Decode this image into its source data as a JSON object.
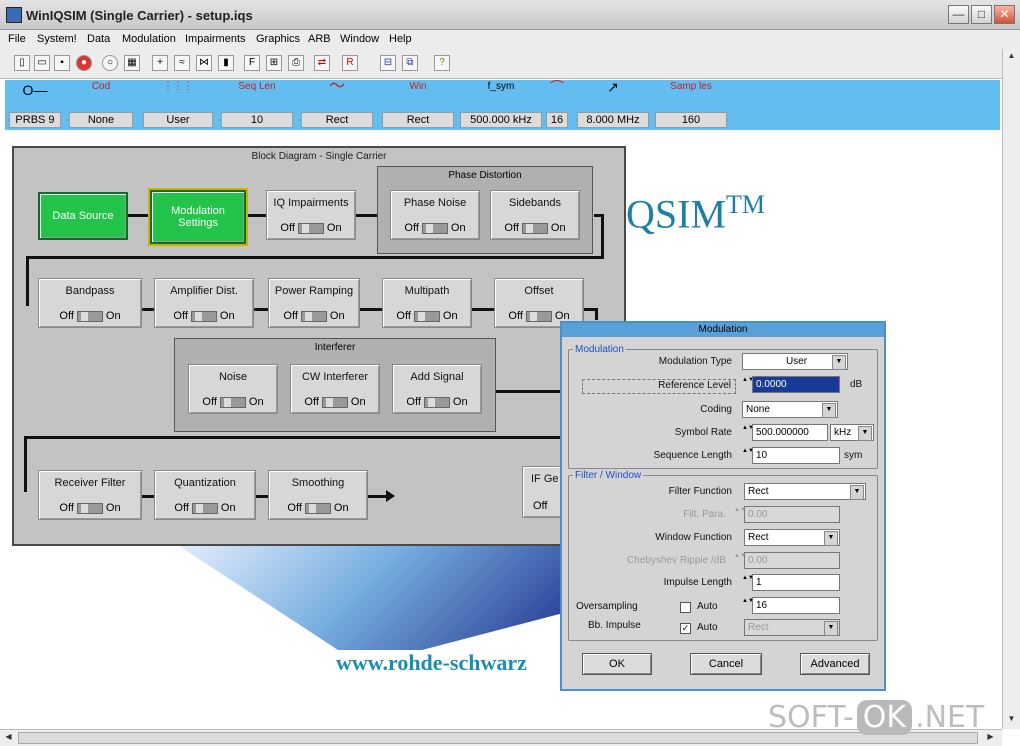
{
  "window": {
    "title": "WinIQSIM (Single Carrier) - setup.iqs"
  },
  "menu": [
    "File",
    "System!",
    "Data",
    "Modulation",
    "Impairments",
    "Graphics",
    "ARB",
    "Window",
    "Help"
  ],
  "params": [
    {
      "icon": "O—",
      "value": "PRBS 9"
    },
    {
      "icon": "Cod",
      "value": "None"
    },
    {
      "icon": "⋮⋮⋮",
      "value": "User"
    },
    {
      "icon": "Seq Len",
      "value": "10"
    },
    {
      "icon": "〜",
      "value": "Rect"
    },
    {
      "icon": "Win",
      "value": "Rect"
    },
    {
      "icon": "f_sym",
      "value": "500.000 kHz"
    },
    {
      "icon": "⌒",
      "value": "16"
    },
    {
      "icon": "↗",
      "value": "8.000 MHz"
    },
    {
      "icon": "Samp les",
      "value": "160"
    }
  ],
  "diagram": {
    "title": "Block Diagram - Single Carrier",
    "phase_group": "Phase Distortion",
    "interferer_group": "Interferer",
    "off": "Off",
    "on": "On",
    "blocks": {
      "data_source": "Data Source",
      "modulation": "Modulation Settings",
      "iq": "IQ Impairments",
      "phase_noise": "Phase Noise",
      "sidebands": "Sidebands",
      "bandpass": "Bandpass",
      "amplifier": "Amplifier Dist.",
      "power_ramping": "Power Ramping",
      "multipath": "Multipath",
      "offset": "Offset",
      "noise": "Noise",
      "cw": "CW Interferer",
      "add_signal": "Add Signal",
      "receiver": "Receiver Filter",
      "quantization": "Quantization",
      "smoothing": "Smoothing",
      "if_gen": "IF Ge"
    }
  },
  "logo": {
    "text": "QSIM",
    "tm": "TM",
    "url": "www.rohde-schwarz"
  },
  "dialog": {
    "title": "Modulation",
    "sec1": "Modulation",
    "sec2": "Filter / Window",
    "mod_type_label": "Modulation Type",
    "mod_type": "User",
    "ref_level_label": "Reference Level",
    "ref_level": "0.0000",
    "ref_unit": "dB",
    "coding_label": "Coding",
    "coding": "None",
    "symrate_label": "Symbol Rate",
    "symrate": "500.000000",
    "symrate_unit": "kHz",
    "seqlen_label": "Sequence Length",
    "seqlen": "10",
    "seqlen_unit": "sym",
    "filter_label": "Filter Function",
    "filter": "Rect",
    "filt_param_label": "Filt. Para.",
    "filt_param": "0.00",
    "window_label": "Window Function",
    "window": "Rect",
    "cheb_label": "Chebyshev Ripple /dB",
    "cheb": "0.00",
    "impulse_label": "Impulse Length",
    "impulse": "1",
    "oversampling_label": "Oversampling",
    "oversampling": "16",
    "auto": "Auto",
    "bb_label": "Bb. Impulse",
    "bb": "Rect",
    "ok": "OK",
    "cancel": "Cancel",
    "advanced": "Advanced"
  },
  "watermark": {
    "a": "SOFT-",
    "b": "OK",
    "c": ".NET"
  }
}
